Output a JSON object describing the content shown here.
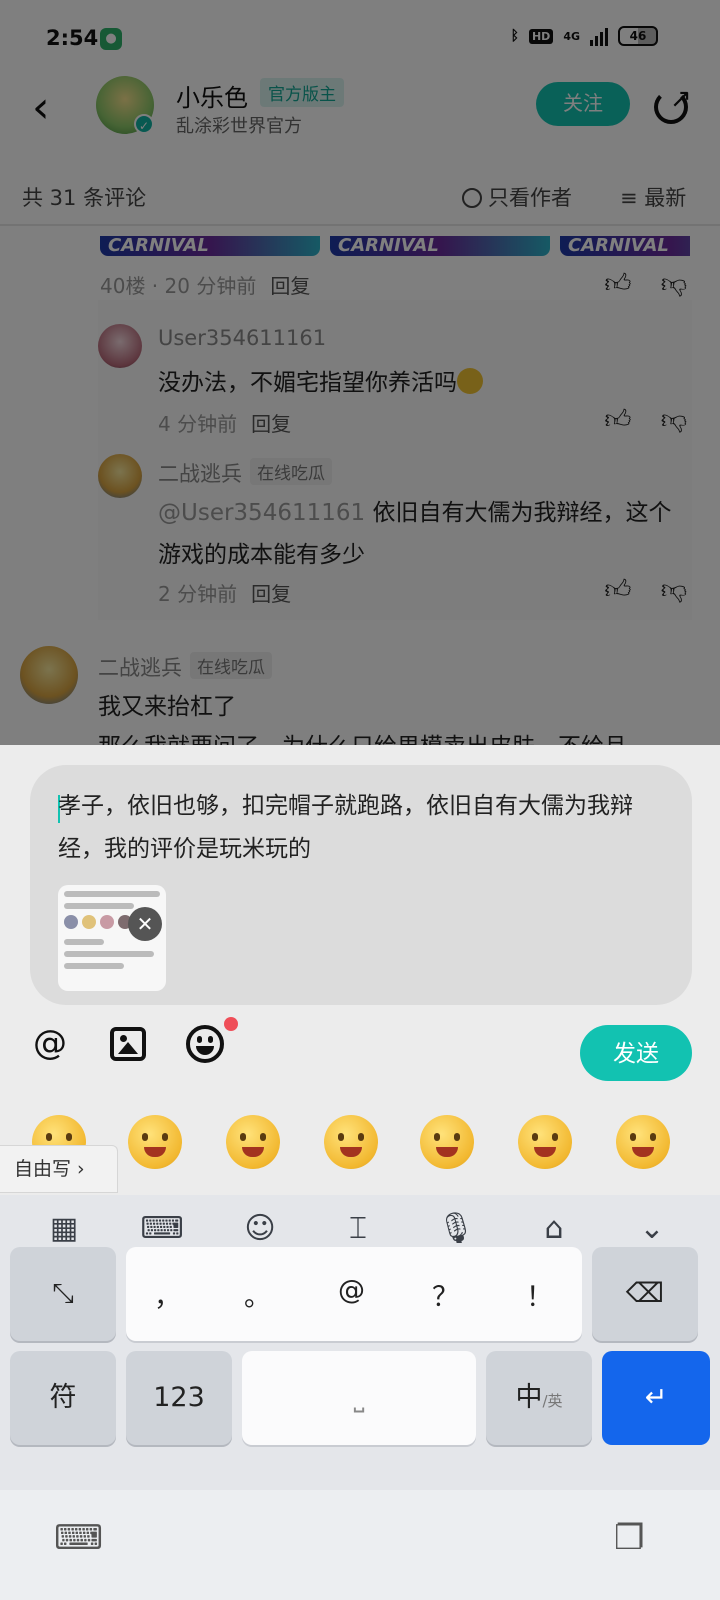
{
  "status_bar": {
    "time": "2:54",
    "network": "4G",
    "hd": "HD",
    "battery": "46"
  },
  "header": {
    "author_name": "小乐色",
    "author_badge": "官方版主",
    "author_subtitle": "乱涂彩世界官方",
    "follow_label": "关注"
  },
  "sort_bar": {
    "count_label": "共 31 条评论",
    "only_author_label": "只看作者",
    "sort_label": "最新"
  },
  "thumb_strip": {
    "text": "CARNIVAL"
  },
  "comments": [
    {
      "floor_meta": "40楼 · 20 分钟前",
      "reply_label": "回复"
    },
    {
      "user": "User354611161",
      "text": "没办法，不媚宅指望你养活吗",
      "time": "4 分钟前",
      "reply_label": "回复"
    },
    {
      "user": "二战逃兵",
      "tag": "在线吃瓜",
      "mention": "@User354611161",
      "text": "依旧自有大儒为我辩经，这个游戏的成本能有多少",
      "time": "2 分钟前",
      "reply_label": "回复"
    },
    {
      "user": "二战逃兵",
      "tag": "在线吃瓜",
      "text": "我又来抬杠了",
      "text2": "那么我就要问了，为什么只给男模卖出皮肤，不给且"
    }
  ],
  "composer": {
    "input_text": "孝子，依旧也够，扣完帽子就跑路，依旧自有大儒为我辩经，我的评价是玩米玩的",
    "at_symbol": "@",
    "send_label": "发送",
    "freewrite_label": "自由写",
    "emoji_names": [
      "curious-emoji",
      "grin-emoji",
      "sly-emoji",
      "eating-emoji",
      "love-emoji",
      "sunglasses-emoji",
      "smirk-emoji"
    ]
  },
  "keyboard": {
    "row1": [
      "，",
      "。",
      "@",
      "？",
      "！"
    ],
    "symbol_key": "符",
    "number_key": "123",
    "lang_key_main": "中",
    "lang_key_alt": "/英"
  },
  "colors": {
    "accent": "#12c2b1",
    "enter_key": "#1466ec",
    "badge_dot": "#ef4e58"
  }
}
